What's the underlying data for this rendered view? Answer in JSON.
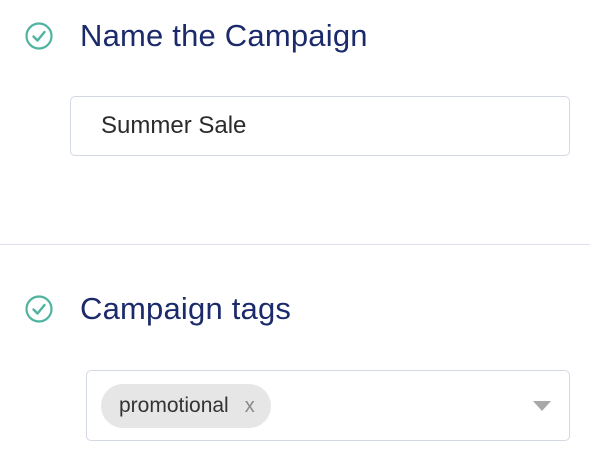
{
  "sections": {
    "name": {
      "title": "Name the Campaign",
      "status_icon": "check-circle-icon",
      "input_value": "Summer Sale"
    },
    "tags": {
      "title": "Campaign tags",
      "status_icon": "check-circle-icon",
      "tags": [
        {
          "label": "promotional",
          "remove_label": "x"
        }
      ],
      "dropdown_icon": "caret-down-icon"
    }
  },
  "colors": {
    "heading": "#1b2a6b",
    "check": "#4fb3a0",
    "border": "#d3d8e5",
    "chip_bg": "#e6e6e6"
  }
}
